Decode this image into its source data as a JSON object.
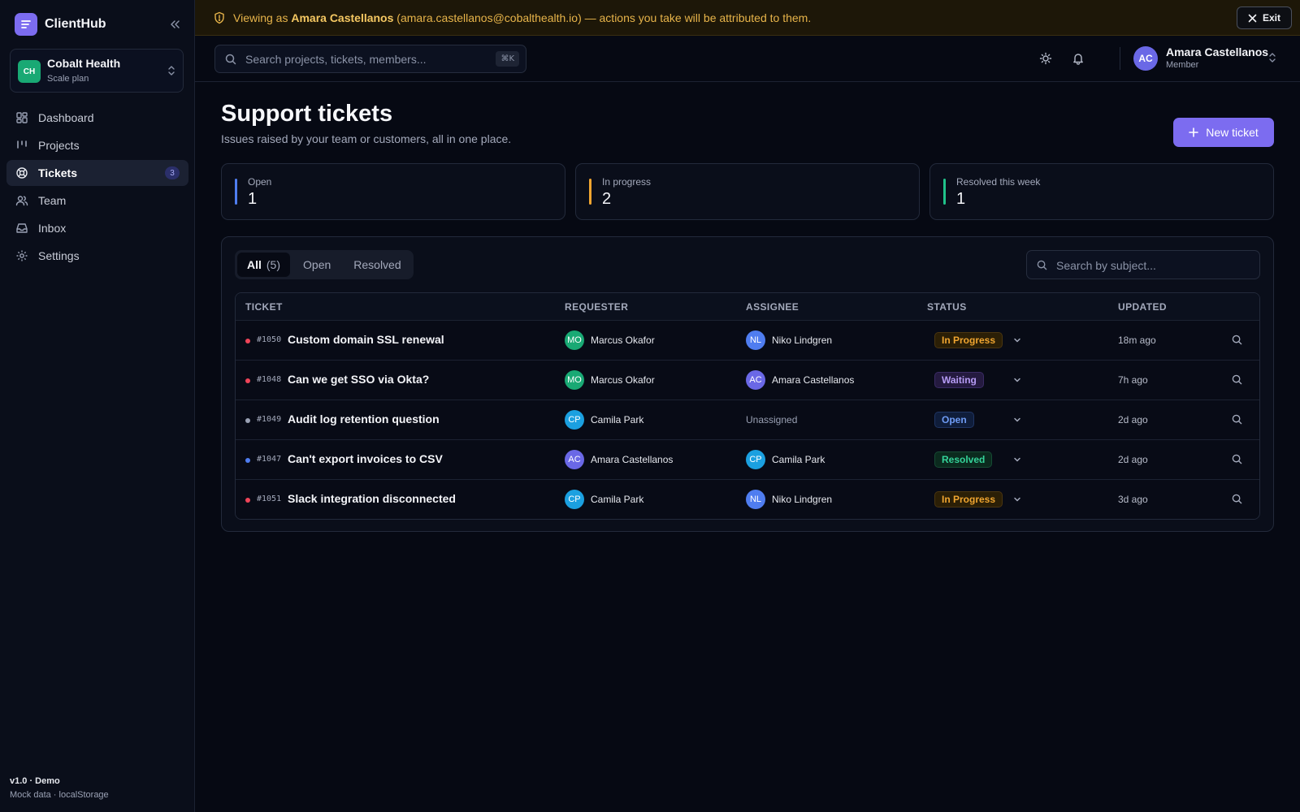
{
  "app": {
    "name": "ClientHub",
    "version": "v1.0 · Demo",
    "version_sub": "Mock data · localStorage"
  },
  "workspace": {
    "initials": "CH",
    "name": "Cobalt Health",
    "plan": "Scale plan",
    "color": "#19a974"
  },
  "nav": [
    {
      "label": "Dashboard",
      "icon": "dashboard-icon"
    },
    {
      "label": "Projects",
      "icon": "projects-icon"
    },
    {
      "label": "Tickets",
      "icon": "tickets-icon",
      "badge": "3",
      "active": true
    },
    {
      "label": "Team",
      "icon": "team-icon"
    },
    {
      "label": "Inbox",
      "icon": "inbox-icon"
    },
    {
      "label": "Settings",
      "icon": "settings-icon"
    }
  ],
  "banner": {
    "prefix": "Viewing as ",
    "name": "Amara Castellanos",
    "suffix": " (amara.castellanos@cobalthealth.io) — actions you take will be attributed to them.",
    "exit_label": "Exit"
  },
  "header": {
    "search_placeholder": "Search projects, tickets, members...",
    "shortcut": "⌘K",
    "user": {
      "initials": "AC",
      "name": "Amara Castellanos",
      "role": "Member"
    }
  },
  "page": {
    "title": "Support tickets",
    "subtitle": "Issues raised by your team or customers, all in one place.",
    "new_button": "New ticket"
  },
  "stats": [
    {
      "label": "Open",
      "value": "1",
      "color": "#4f7df0"
    },
    {
      "label": "In progress",
      "value": "2",
      "color": "#f0a530"
    },
    {
      "label": "Resolved this week",
      "value": "1",
      "color": "#20c28a"
    }
  ],
  "filters": {
    "tabs": [
      {
        "label": "All",
        "count": "(5)",
        "active": true
      },
      {
        "label": "Open"
      },
      {
        "label": "Resolved"
      }
    ],
    "search_placeholder": "Search by subject..."
  },
  "table": {
    "columns": [
      "TICKET",
      "REQUESTER",
      "ASSIGNEE",
      "STATUS",
      "UPDATED"
    ],
    "rows": [
      {
        "id": "#1050",
        "subject": "Custom domain SSL renewal",
        "priority_color": "#ef4458",
        "requester": {
          "initials": "MO",
          "name": "Marcus Okafor",
          "color": "#19a974"
        },
        "assignee": {
          "initials": "NL",
          "name": "Niko Lindgren",
          "color": "#4f7df0"
        },
        "status": "In Progress",
        "updated": "18m ago"
      },
      {
        "id": "#1048",
        "subject": "Can we get SSO via Okta?",
        "priority_color": "#ef4458",
        "requester": {
          "initials": "MO",
          "name": "Marcus Okafor",
          "color": "#19a974"
        },
        "assignee": {
          "initials": "AC",
          "name": "Amara Castellanos",
          "color": "#6a68e6"
        },
        "status": "Waiting",
        "updated": "7h ago"
      },
      {
        "id": "#1049",
        "subject": "Audit log retention question",
        "priority_color": "#9aa1b4",
        "requester": {
          "initials": "CP",
          "name": "Camila Park",
          "color": "#1ba0e0"
        },
        "assignee": null,
        "unassigned_label": "Unassigned",
        "status": "Open",
        "updated": "2d ago"
      },
      {
        "id": "#1047",
        "subject": "Can't export invoices to CSV",
        "priority_color": "#4f7df0",
        "requester": {
          "initials": "AC",
          "name": "Amara Castellanos",
          "color": "#6a68e6"
        },
        "assignee": {
          "initials": "CP",
          "name": "Camila Park",
          "color": "#1ba0e0"
        },
        "status": "Resolved",
        "updated": "2d ago"
      },
      {
        "id": "#1051",
        "subject": "Slack integration disconnected",
        "priority_color": "#ef4458",
        "requester": {
          "initials": "CP",
          "name": "Camila Park",
          "color": "#1ba0e0"
        },
        "assignee": {
          "initials": "NL",
          "name": "Niko Lindgren",
          "color": "#4f7df0"
        },
        "status": "In Progress",
        "updated": "3d ago"
      }
    ]
  },
  "status_styles": {
    "In Progress": {
      "bg": "#2b1f06",
      "fg": "#f0a530",
      "border": "#4a3510"
    },
    "Waiting": {
      "bg": "#241a3f",
      "fg": "#b69cf5",
      "border": "#3a2b64"
    },
    "Open": {
      "bg": "#0f1d3a",
      "fg": "#6f9cf5",
      "border": "#1f3563"
    },
    "Resolved": {
      "bg": "#0b2a1e",
      "fg": "#34d399",
      "border": "#164a34"
    }
  }
}
